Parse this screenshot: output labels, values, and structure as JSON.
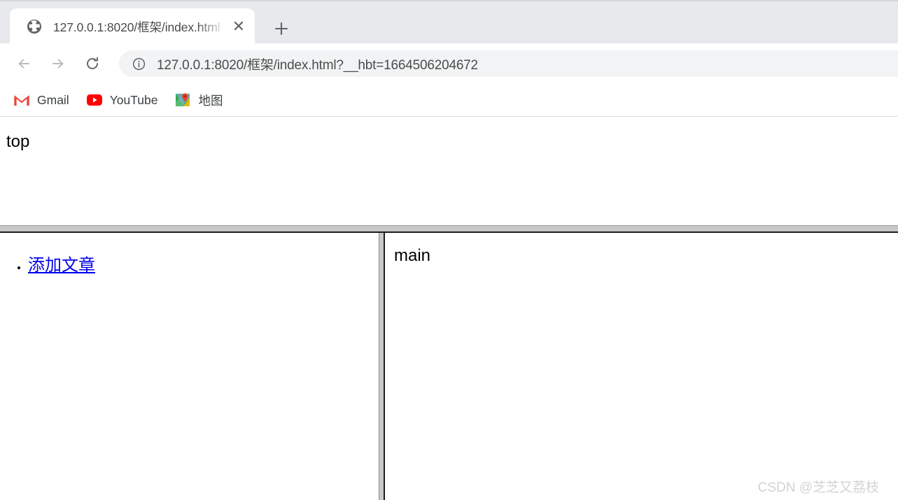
{
  "browser": {
    "tab": {
      "favicon": "globe-icon",
      "title": "127.0.0.1:8020/框架/index.html",
      "close_label": "✕"
    },
    "new_tab_label": "+",
    "toolbar": {
      "back_label": "←",
      "forward_label": "→",
      "reload_label": "↻",
      "site_info_icon": "info-circle-icon",
      "url": "127.0.0.1:8020/框架/index.html?__hbt=1664506204672"
    },
    "bookmarks": [
      {
        "icon": "gmail-icon",
        "label": "Gmail"
      },
      {
        "icon": "youtube-icon",
        "label": "YouTube"
      },
      {
        "icon": "google-maps-icon",
        "label": "地图"
      }
    ]
  },
  "page": {
    "top_frame": {
      "label": "top"
    },
    "left_frame": {
      "items": [
        {
          "label": "添加文章"
        }
      ]
    },
    "main_frame": {
      "label": "main"
    },
    "watermark": "CSDN @芝芝又荔枝"
  },
  "colors": {
    "tabstrip_bg": "#e7e9ed",
    "omnibox_bg": "#f1f3f4",
    "link": "#0000ee",
    "splitter": "#c8c8c8",
    "watermark": "#d3d3d3"
  }
}
